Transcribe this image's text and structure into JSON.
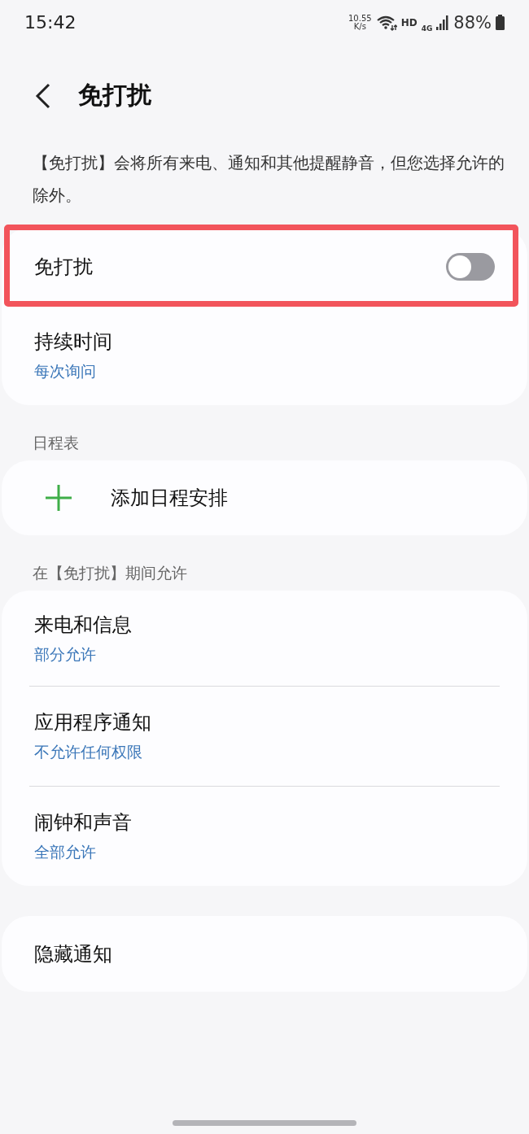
{
  "status_bar": {
    "time": "15:42",
    "speed_value": "10.55",
    "speed_unit": "K/s",
    "hd": "HD",
    "network": "4G",
    "battery": "88%"
  },
  "header": {
    "title": "免打扰"
  },
  "description": "【免打扰】会将所有来电、通知和其他提醒静音，但您选择允许的除外。",
  "groups": [
    {
      "items": [
        {
          "kind": "switch",
          "label": "免打扰",
          "on": false,
          "highlighted": true
        },
        {
          "kind": "detail",
          "label": "持续时间",
          "value": "每次询问"
        }
      ]
    },
    {
      "header": "日程表",
      "items": [
        {
          "kind": "add",
          "label": "添加日程安排"
        }
      ]
    },
    {
      "header": "在【免打扰】期间允许",
      "items": [
        {
          "kind": "detail",
          "label": "来电和信息",
          "value": "部分允许"
        },
        {
          "kind": "detail",
          "label": "应用程序通知",
          "value": "不允许任何权限"
        },
        {
          "kind": "detail",
          "label": "闹钟和声音",
          "value": "全部允许"
        }
      ]
    },
    {
      "items": [
        {
          "kind": "plain",
          "label": "隐藏通知"
        }
      ]
    }
  ]
}
